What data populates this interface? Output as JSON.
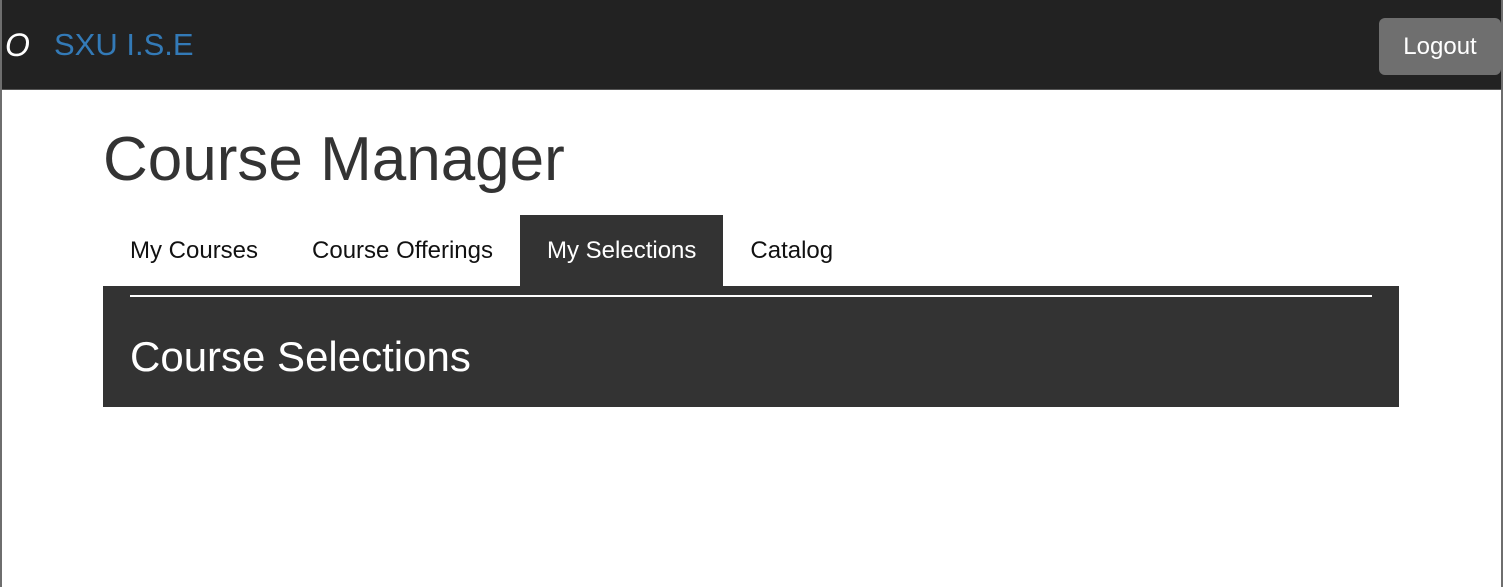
{
  "header": {
    "logo_glyph": "O",
    "brand": "SXU I.S.E",
    "logout_label": "Logout"
  },
  "page": {
    "title": "Course Manager"
  },
  "tabs": [
    {
      "label": "My Courses",
      "active": false
    },
    {
      "label": "Course Offerings",
      "active": false
    },
    {
      "label": "My Selections",
      "active": true
    },
    {
      "label": "Catalog",
      "active": false
    }
  ],
  "panel": {
    "heading": "Course Selections"
  },
  "colors": {
    "topbar": "#222222",
    "brand": "#337ab7",
    "logout_button": "#6f6f6f",
    "active_tab": "#333333",
    "panel": "#333333",
    "title_text": "#333333"
  }
}
